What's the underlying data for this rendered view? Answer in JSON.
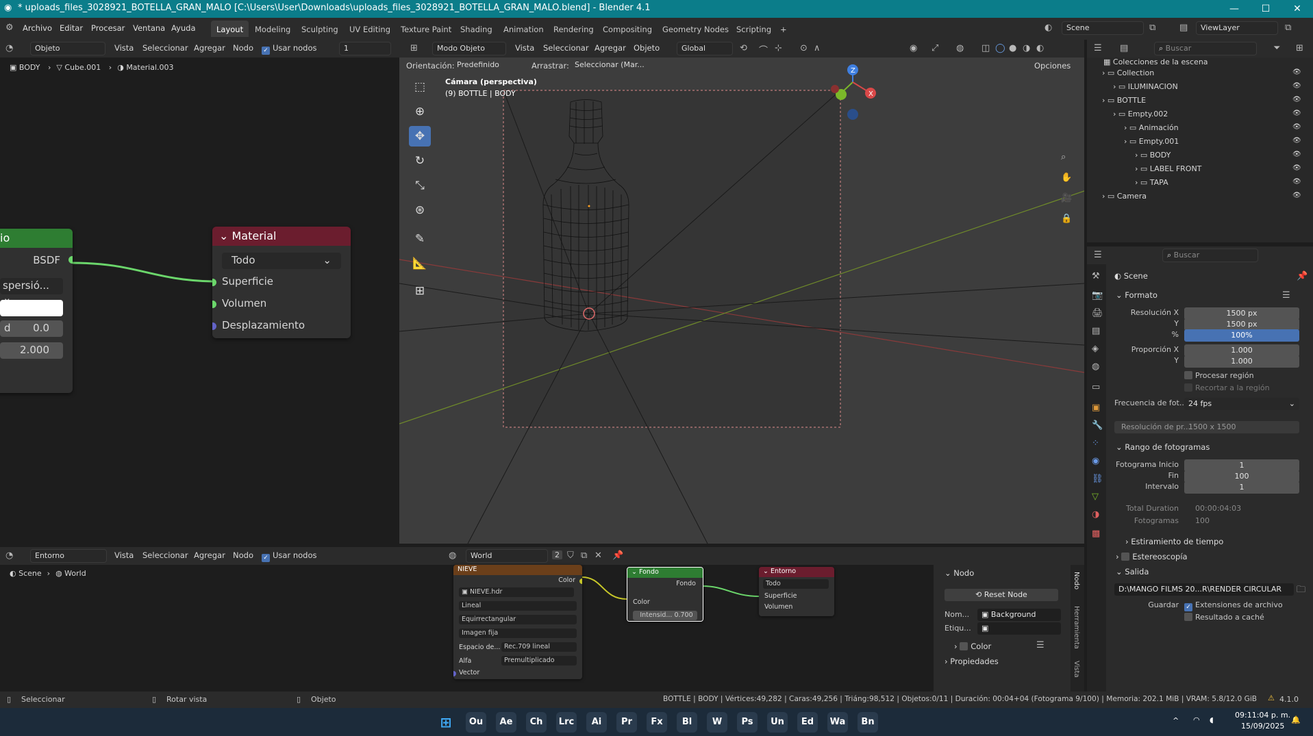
{
  "window": {
    "title": "* uploads_files_3028921_BOTELLA_GRAN_MALO [C:\\Users\\User\\Downloads\\uploads_files_3028921_BOTELLA_GRAN_MALO.blend] - Blender 4.1",
    "minimize": "—",
    "maximize": "☐",
    "close": "✕"
  },
  "menu": [
    "Archivo",
    "Editar",
    "Procesar",
    "Ventana",
    "Ayuda"
  ],
  "workspaces": [
    "Layout",
    "Modeling",
    "Sculpting",
    "UV Editing",
    "Texture Paint",
    "Shading",
    "Animation",
    "Rendering",
    "Compositing",
    "Geometry Nodes",
    "Scripting",
    "+"
  ],
  "scene": {
    "name": "Scene",
    "viewlayer": "ViewLayer"
  },
  "node_editor": {
    "mode": "Objeto",
    "menus": [
      "Vista",
      "Seleccionar",
      "Agregar",
      "Nodo"
    ],
    "use_nodes": "Usar nodos",
    "slot": "1",
    "breadcrumb": [
      "BODY",
      "Cube.001",
      "Material.003"
    ],
    "bsdf_node": {
      "title": "io",
      "output": "BSDF",
      "dropdown": "spersió...",
      "field1_label": "d",
      "field1_value": "0.0",
      "field2_value": "2.000"
    },
    "material_node": {
      "title": "Material",
      "target": "Todo",
      "inputs": [
        "Superficie",
        "Volumen",
        "Desplazamiento"
      ]
    }
  },
  "viewport": {
    "mode": "Modo Objeto",
    "menus": [
      "Vista",
      "Seleccionar",
      "Agregar",
      "Objeto"
    ],
    "orientation": "Global",
    "orient_label": "Orientación:",
    "orient_value": "Predefinido",
    "drag_label": "Arrastrar:",
    "drag_value": "Seleccionar (Mar...",
    "options": "Opciones",
    "camera_label": "Cámara (perspectiva)",
    "object_label": "(9) BOTTLE | BODY"
  },
  "outliner": {
    "search": "Buscar",
    "root": "Colecciones de la escena",
    "rows": [
      {
        "name": "Collection",
        "indent": 0
      },
      {
        "name": "ILUMINACION",
        "indent": 1
      },
      {
        "name": "BOTTLE",
        "indent": 0
      },
      {
        "name": "Empty.002",
        "indent": 1
      },
      {
        "name": "Animación",
        "indent": 2
      },
      {
        "name": "Empty.001",
        "indent": 2
      },
      {
        "name": "BODY",
        "indent": 3
      },
      {
        "name": "LABEL FRONT",
        "indent": 3
      },
      {
        "name": "TAPA",
        "indent": 3
      },
      {
        "name": "Camera",
        "indent": 0
      }
    ]
  },
  "properties": {
    "search": "Buscar",
    "scene": "Scene",
    "formato": "Formato",
    "res_x_label": "Resolución X",
    "res_x": "1500 px",
    "y_label": "Y",
    "res_y": "1500 px",
    "pct_label": "%",
    "pct": "100%",
    "aspect_x_label": "Proporción X",
    "aspect_x": "1.000",
    "aspect_y": "1.000",
    "region": "Procesar región",
    "crop": "Recortar a la región",
    "fps_label": "Frecuencia de fot...",
    "fps": "24 fps",
    "preview": "Resolución de pr...",
    "preview_value": "1500 x 1500",
    "range": "Rango de fotogramas",
    "start_label": "Fotograma Inicio",
    "start": "1",
    "end_label": "Fin",
    "end": "100",
    "step_label": "Intervalo",
    "step": "1",
    "total_label": "Total Duration",
    "total": "00:00:04:03",
    "frames_label": "Fotogramas",
    "frames": "100",
    "stretch": "Estiramiento de tiempo",
    "stereo": "Estereoscopía",
    "output": "Salida",
    "path": "D:\\MANGO FILMS 20...R\\RENDER CIRCULAR",
    "save_label": "Guardar",
    "ext": "Extensiones de archivo",
    "cache": "Resultado a caché"
  },
  "world_editor": {
    "type": "Entorno",
    "menus": [
      "Vista",
      "Seleccionar",
      "Agregar",
      "Nodo"
    ],
    "use_nodes": "Usar nodos",
    "world": "World",
    "users": "2",
    "breadcrumb": [
      "Scene",
      "World"
    ],
    "tex_node": {
      "title": "NIEVE",
      "out": "Color",
      "image": "NIEVE.hdr",
      "interp": "Lineal",
      "proj": "Equirrectangular",
      "ext": "Imagen fija",
      "cs_label": "Espacio de...",
      "cs": "Rec.709 lineal",
      "alpha_label": "Alfa",
      "alpha": "Premultiplicado",
      "vector": "Vector"
    },
    "bg_node": {
      "title": "Fondo",
      "out": "Fondo",
      "color": "Color",
      "strength": "Intensid...",
      "strength_val": "0.700"
    },
    "out_node": {
      "title": "Entorno",
      "target": "Todo",
      "s": "Superficie",
      "v": "Volumen"
    },
    "npanel": {
      "title": "Nodo",
      "reset": "Reset Node",
      "name_label": "Nom...",
      "name": "Background",
      "label_label": "Etiqu...",
      "color": "Color",
      "props": "Propiedades",
      "tabs": [
        "Nodo",
        "Herramienta",
        "Vista"
      ]
    }
  },
  "status": {
    "left": [
      "Seleccionar",
      "Rotar vista",
      "Objeto"
    ],
    "stats": "BOTTLE | BODY | Vértices:49,282 | Caras:49,256 | Triáng:98,512 | Objetos:0/11 | Duración: 00:04+04 (Fotograma 9/100) | Memoria: 202.1 MiB | VRAM: 5.8/12.0 GiB",
    "version": "4.1.0"
  },
  "taskbar": {
    "time": "09:11:04 p. m.",
    "date": "15/09/2025",
    "apps": [
      "Ou",
      "Ae",
      "Ch",
      "Lrc",
      "Ai",
      "Pr",
      "Fx",
      "Bl",
      "W",
      "Ps",
      "Un",
      "Ed",
      "Wa",
      "Bn"
    ]
  }
}
